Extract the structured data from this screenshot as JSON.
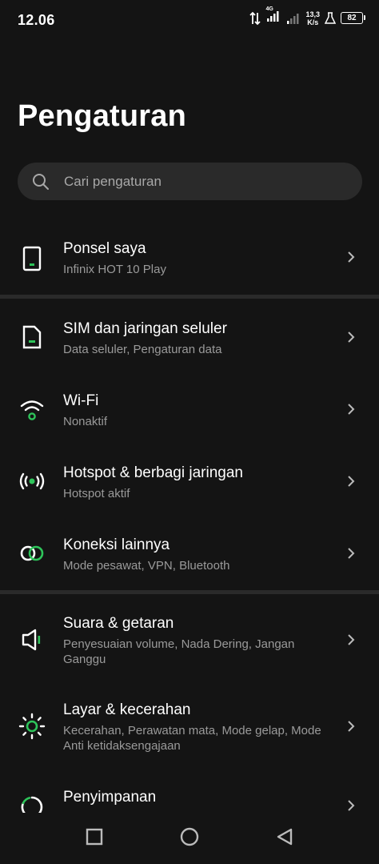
{
  "status_bar": {
    "time": "12.06",
    "network_type": "4G",
    "speed_value": "13,3",
    "speed_unit": "K/s",
    "battery": "82"
  },
  "page_title": "Pengaturan",
  "search": {
    "placeholder": "Cari pengaturan"
  },
  "items": [
    {
      "title": "Ponsel saya",
      "subtitle": "Infinix HOT 10 Play",
      "icon": "phone-icon"
    },
    {
      "title": "SIM dan jaringan seluler",
      "subtitle": "Data seluler, Pengaturan data",
      "icon": "sim-card-icon"
    },
    {
      "title": "Wi-Fi",
      "subtitle": "Nonaktif",
      "icon": "wifi-icon"
    },
    {
      "title": "Hotspot & berbagi jaringan",
      "subtitle": "Hotspot aktif",
      "icon": "hotspot-icon"
    },
    {
      "title": "Koneksi lainnya",
      "subtitle": "Mode pesawat, VPN, Bluetooth",
      "icon": "link-icon"
    },
    {
      "title": "Suara & getaran",
      "subtitle": "Penyesuaian volume, Nada Dering, Jangan Ganggu",
      "icon": "speaker-icon"
    },
    {
      "title": "Layar & kecerahan",
      "subtitle": "Kecerahan, Perawatan mata, Mode gelap, Mode Anti ketidaksengajaan",
      "icon": "brightness-icon"
    },
    {
      "title": "Penyimpanan",
      "subtitle": "",
      "icon": "storage-icon"
    }
  ],
  "colors": {
    "accent": "#2ec45a",
    "background": "#141414",
    "surface": "#2a2a2a",
    "secondary_text": "#9a9a9a"
  }
}
